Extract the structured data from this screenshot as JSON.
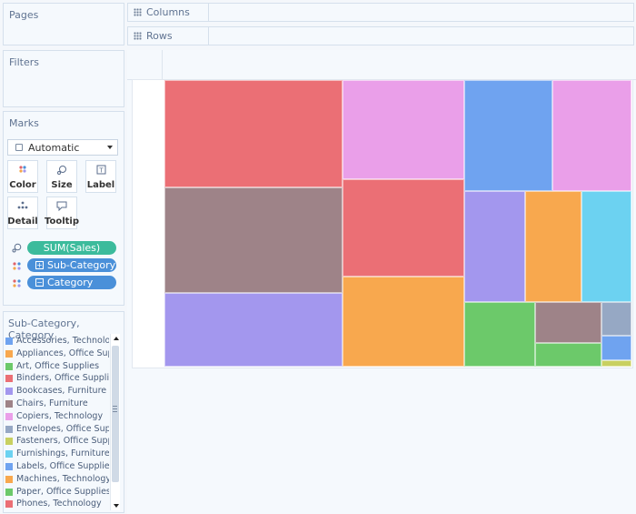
{
  "panels": {
    "pages_title": "Pages",
    "filters_title": "Filters",
    "marks_title": "Marks"
  },
  "shelves": {
    "columns_label": "Columns",
    "rows_label": "Rows"
  },
  "marks": {
    "mark_type": "Automatic",
    "buttons": [
      "Color",
      "Size",
      "Label",
      "Detail",
      "Tooltip"
    ],
    "pills": [
      {
        "label": "SUM(Sales)",
        "icon": "size-icon",
        "color": "#3cbb9c"
      },
      {
        "label": "Sub-Category",
        "icon": "color-dots-icon",
        "color": "#4a90d9"
      },
      {
        "label": "Category",
        "icon": "color-dots-icon",
        "color": "#4a90d9"
      }
    ]
  },
  "legend": {
    "title": "Sub-Category, Category",
    "items": [
      {
        "label": "Accessories, Technology",
        "color": "#6fa3f0"
      },
      {
        "label": "Appliances, Office Supp...",
        "color": "#f8a84e"
      },
      {
        "label": "Art, Office Supplies",
        "color": "#6cc96a"
      },
      {
        "label": "Binders, Office Supplies",
        "color": "#eb6f75"
      },
      {
        "label": "Bookcases, Furniture",
        "color": "#a397ee"
      },
      {
        "label": "Chairs, Furniture",
        "color": "#9e8388"
      },
      {
        "label": "Copiers, Technology",
        "color": "#ea9fe9"
      },
      {
        "label": "Envelopes, Office Suppl...",
        "color": "#96a8c4"
      },
      {
        "label": "Fasteners, Office Suppli...",
        "color": "#c8d060"
      },
      {
        "label": "Furnishings, Furniture",
        "color": "#6cd2f1"
      },
      {
        "label": "Labels, Office Supplies",
        "color": "#6fa3f0"
      },
      {
        "label": "Machines, Technology",
        "color": "#f8a84e"
      },
      {
        "label": "Paper, Office Supplies",
        "color": "#6cc96a"
      },
      {
        "label": "Phones, Technology",
        "color": "#eb6f75"
      }
    ]
  },
  "treemap": {
    "tiles": [
      {
        "name": "phones",
        "color": "#eb6f75"
      },
      {
        "name": "chairs",
        "color": "#9e8388"
      },
      {
        "name": "bookcases",
        "color": "#a397ee"
      },
      {
        "name": "copiers",
        "color": "#ea9fe9"
      },
      {
        "name": "binders",
        "color": "#eb6f75"
      },
      {
        "name": "machines",
        "color": "#f8a84e"
      },
      {
        "name": "accessories",
        "color": "#6fa3f0"
      },
      {
        "name": "copiers-2",
        "color": "#ea9fe9"
      },
      {
        "name": "bookcases-2",
        "color": "#a397ee"
      },
      {
        "name": "appliances",
        "color": "#f8a84e"
      },
      {
        "name": "furnishings",
        "color": "#6cd2f1"
      },
      {
        "name": "art",
        "color": "#6cc96a"
      },
      {
        "name": "chairs-2",
        "color": "#9e8388"
      },
      {
        "name": "envelopes",
        "color": "#96a8c4"
      },
      {
        "name": "art-2",
        "color": "#6cc96a"
      },
      {
        "name": "labels",
        "color": "#6fa3f0"
      },
      {
        "name": "fasteners",
        "color": "#c8d060"
      }
    ]
  }
}
